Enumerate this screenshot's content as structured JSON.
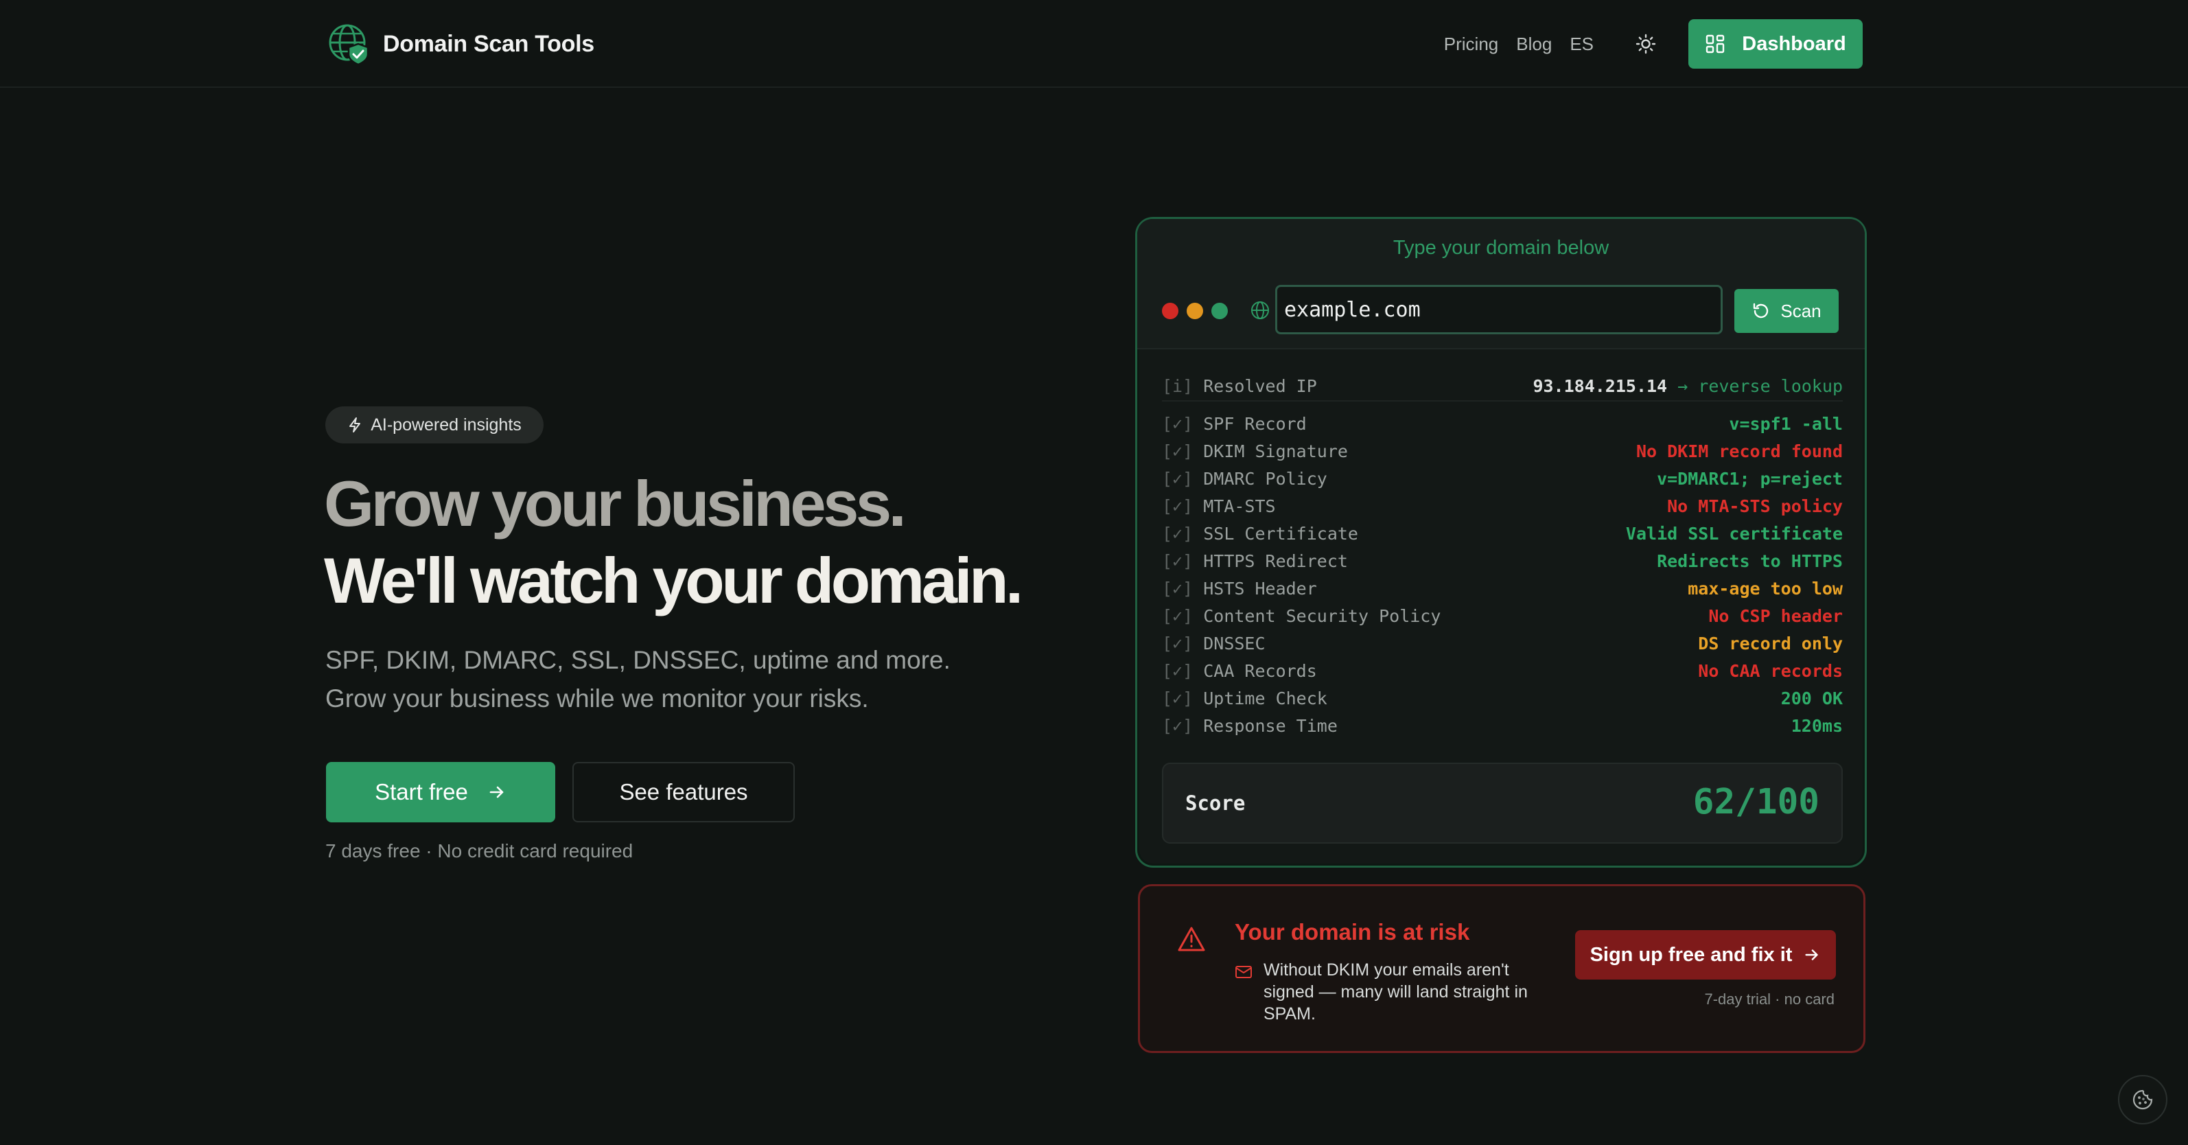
{
  "header": {
    "brand": "Domain Scan Tools",
    "nav": {
      "pricing": "Pricing",
      "blog": "Blog",
      "lang": "ES"
    },
    "dashboard_label": "Dashboard"
  },
  "hero": {
    "badge": "AI-powered insights",
    "headline_1": "Grow your business.",
    "headline_2": "We'll watch your domain.",
    "sub_1": "SPF, DKIM, DMARC, SSL, DNSSEC, uptime and more.",
    "sub_2": "Grow your business while we monitor your risks.",
    "start_label": "Start free",
    "features_label": "See features",
    "note": "7 days free · No credit card required"
  },
  "scanner": {
    "title": "Type your domain below",
    "domain_value": "example.com",
    "scan_label": "Scan",
    "resolved": {
      "prefix": "[i]",
      "label": "Resolved IP",
      "ip": "93.184.215.14",
      "link": "→ reverse lookup"
    },
    "checks": [
      {
        "prefix": "[✓]",
        "label": "SPF Record",
        "result": "v=spf1 -all",
        "status": "ok"
      },
      {
        "prefix": "[✓]",
        "label": "DKIM Signature",
        "result": "No DKIM record found",
        "status": "bad"
      },
      {
        "prefix": "[✓]",
        "label": "DMARC Policy",
        "result": "v=DMARC1; p=reject",
        "status": "ok"
      },
      {
        "prefix": "[✓]",
        "label": "MTA-STS",
        "result": "No MTA-STS policy",
        "status": "bad"
      },
      {
        "prefix": "[✓]",
        "label": "SSL Certificate",
        "result": "Valid SSL certificate",
        "status": "ok"
      },
      {
        "prefix": "[✓]",
        "label": "HTTPS Redirect",
        "result": "Redirects to HTTPS",
        "status": "ok"
      },
      {
        "prefix": "[✓]",
        "label": "HSTS Header",
        "result": "max-age too low",
        "status": "warn"
      },
      {
        "prefix": "[✓]",
        "label": "Content Security Policy",
        "result": "No CSP header",
        "status": "bad"
      },
      {
        "prefix": "[✓]",
        "label": "DNSSEC",
        "result": "DS record only",
        "status": "warn"
      },
      {
        "prefix": "[✓]",
        "label": "CAA Records",
        "result": "No CAA records",
        "status": "bad"
      },
      {
        "prefix": "[✓]",
        "label": "Uptime Check",
        "result": "200 OK",
        "status": "ok"
      },
      {
        "prefix": "[✓]",
        "label": "Response Time",
        "result": "120ms",
        "status": "ok"
      }
    ],
    "score_label": "Score",
    "score_value": "62/100"
  },
  "risk": {
    "title": "Your domain is at risk",
    "text": "Without DKIM your emails aren't signed — many will land straight in SPAM.",
    "button_label": "Sign up free and fix it",
    "note": "7-day trial · no card"
  },
  "colors": {
    "accent": "#2d9a64",
    "ok": "#2fae6a",
    "bad": "#e0302c",
    "warn": "#e9a227",
    "danger_button": "#7e1a1a"
  },
  "icons": [
    "globe-shield-icon",
    "sun-icon",
    "dashboard-grid-icon",
    "lightning-icon",
    "arrow-right-icon",
    "globe-icon",
    "refresh-icon",
    "warning-triangle-icon",
    "mail-icon",
    "cookie-icon"
  ]
}
